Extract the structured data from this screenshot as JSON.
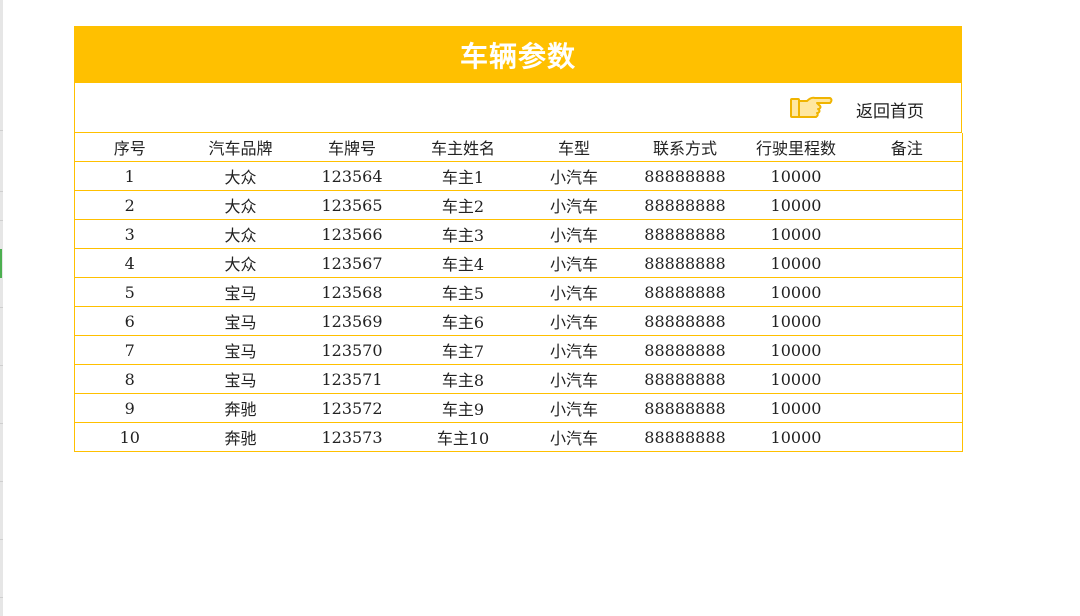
{
  "page": {
    "title": "车辆参数",
    "back_link": "返回首页",
    "hand_icon": "pointing-hand-icon"
  },
  "colors": {
    "accent": "#ffc000",
    "title_text": "#ffffff",
    "body_text": "#222222"
  },
  "table": {
    "columns": [
      "序号",
      "汽车品牌",
      "车牌号",
      "车主姓名",
      "车型",
      "联系方式",
      "行驶里程数",
      "备注"
    ],
    "rows": [
      [
        "1",
        "大众",
        "123564",
        "车主1",
        "小汽车",
        "88888888",
        "10000",
        ""
      ],
      [
        "2",
        "大众",
        "123565",
        "车主2",
        "小汽车",
        "88888888",
        "10000",
        ""
      ],
      [
        "3",
        "大众",
        "123566",
        "车主3",
        "小汽车",
        "88888888",
        "10000",
        ""
      ],
      [
        "4",
        "大众",
        "123567",
        "车主4",
        "小汽车",
        "88888888",
        "10000",
        ""
      ],
      [
        "5",
        "宝马",
        "123568",
        "车主5",
        "小汽车",
        "88888888",
        "10000",
        ""
      ],
      [
        "6",
        "宝马",
        "123569",
        "车主6",
        "小汽车",
        "88888888",
        "10000",
        ""
      ],
      [
        "7",
        "宝马",
        "123570",
        "车主7",
        "小汽车",
        "88888888",
        "10000",
        ""
      ],
      [
        "8",
        "宝马",
        "123571",
        "车主8",
        "小汽车",
        "88888888",
        "10000",
        ""
      ],
      [
        "9",
        "奔驰",
        "123572",
        "车主9",
        "小汽车",
        "88888888",
        "10000",
        ""
      ],
      [
        "10",
        "奔驰",
        "123573",
        "车主10",
        "小汽车",
        "88888888",
        "10000",
        ""
      ]
    ]
  }
}
